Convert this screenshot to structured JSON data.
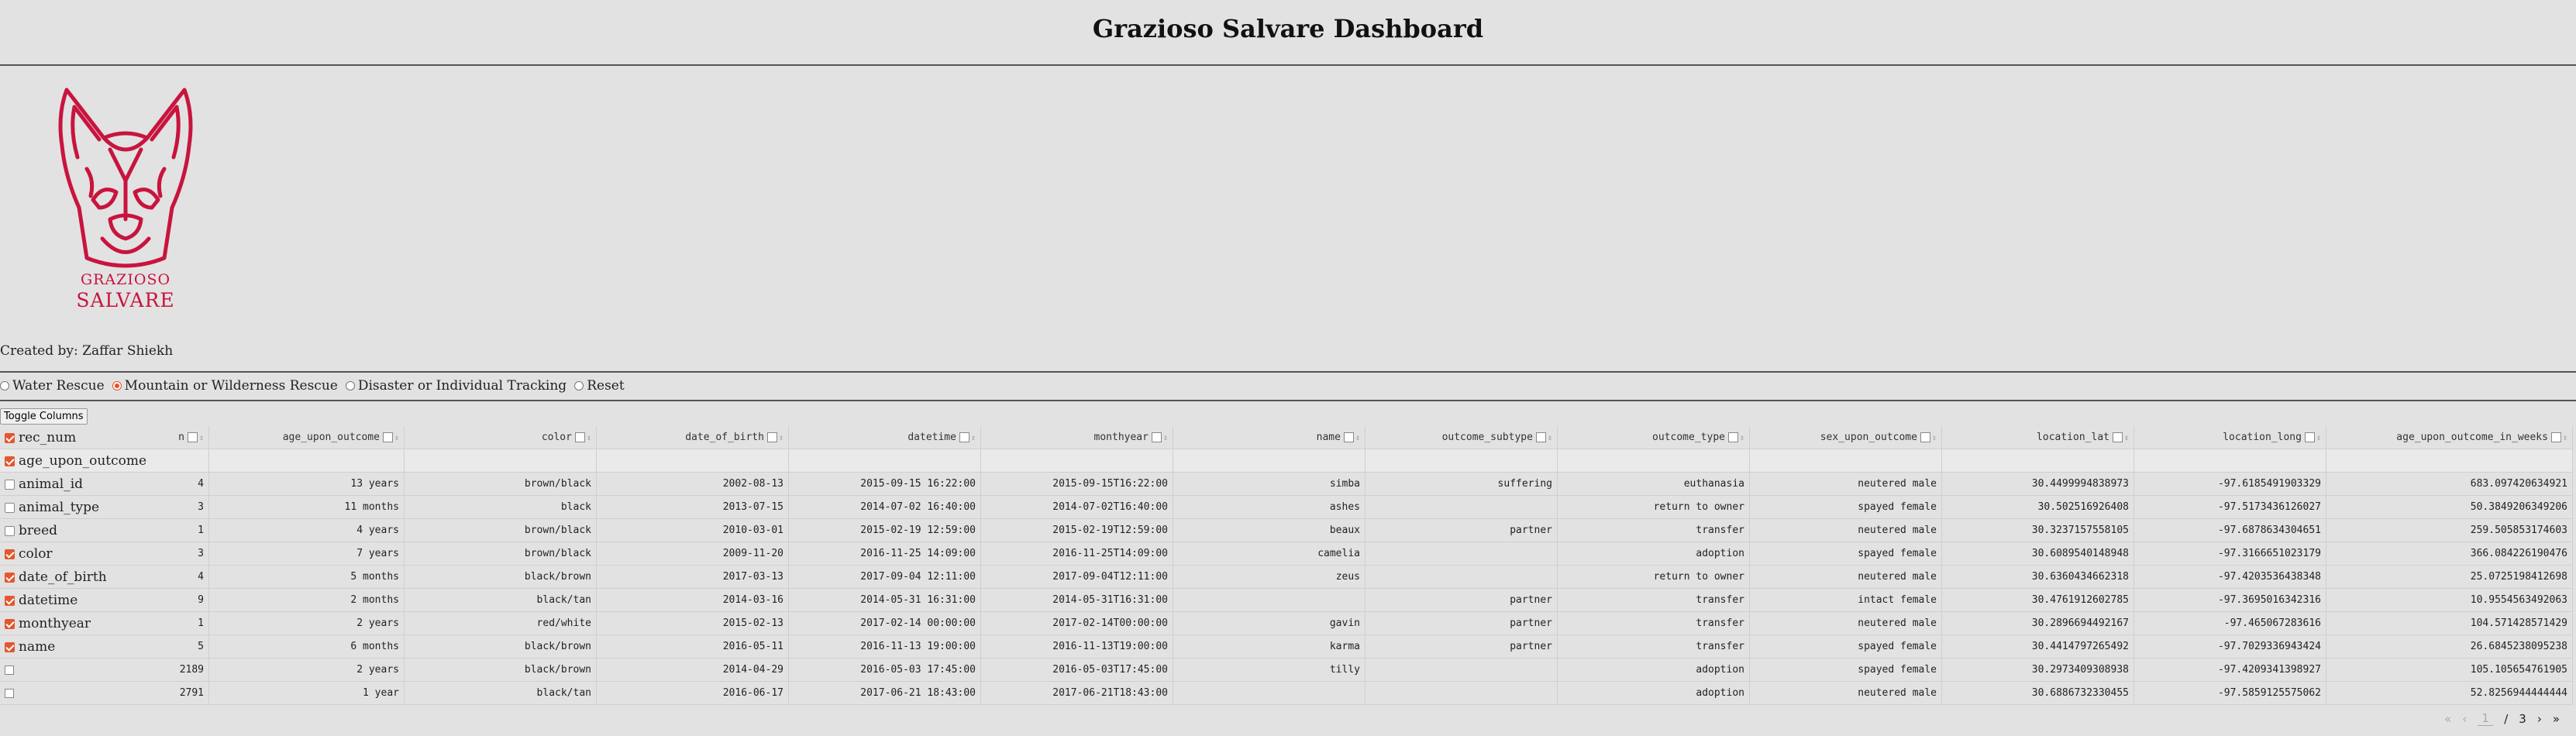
{
  "app": {
    "title": "Grazioso Salvare Dashboard",
    "logo_line1": "GRAZIOSO",
    "logo_line2": "SALVARE",
    "created_by": "Created by: Zaffar Shiekh",
    "brand_color": "#c8143e",
    "accent_color": "#e4572e"
  },
  "filters": {
    "options": [
      {
        "label": "Water Rescue",
        "checked": false
      },
      {
        "label": "Mountain or Wilderness Rescue",
        "checked": true
      },
      {
        "label": "Disaster or Individual Tracking",
        "checked": false
      },
      {
        "label": "Reset",
        "checked": false
      }
    ]
  },
  "toggle_columns_label": "Toggle Columns",
  "column_menu": [
    {
      "label": "rec_num",
      "checked": true
    },
    {
      "label": "age_upon_outcome",
      "checked": true
    },
    {
      "label": "animal_id",
      "checked": false
    },
    {
      "label": "animal_type",
      "checked": false
    },
    {
      "label": "breed",
      "checked": false
    },
    {
      "label": "color",
      "checked": true
    },
    {
      "label": "date_of_birth",
      "checked": true
    },
    {
      "label": "datetime",
      "checked": true
    },
    {
      "label": "monthyear",
      "checked": true
    },
    {
      "label": "name",
      "checked": true
    }
  ],
  "table": {
    "columns": [
      "n",
      "age_upon_outcome",
      "color",
      "date_of_birth",
      "datetime",
      "monthyear",
      "name",
      "outcome_subtype",
      "outcome_type",
      "sex_upon_outcome",
      "location_lat",
      "location_long",
      "age_upon_outcome_in_weeks"
    ],
    "rows": [
      [
        "4",
        "13 years",
        "brown/black",
        "2002-08-13",
        "2015-09-15 16:22:00",
        "2015-09-15T16:22:00",
        "simba",
        "suffering",
        "euthanasia",
        "neutered male",
        "30.4499994838973",
        "-97.6185491903329",
        "683.097420634921"
      ],
      [
        "3",
        "11 months",
        "black",
        "2013-07-15",
        "2014-07-02 16:40:00",
        "2014-07-02T16:40:00",
        "ashes",
        "",
        "return to owner",
        "spayed female",
        "30.502516926408",
        "-97.5173436126027",
        "50.3849206349206"
      ],
      [
        "1",
        "4 years",
        "brown/black",
        "2010-03-01",
        "2015-02-19 12:59:00",
        "2015-02-19T12:59:00",
        "beaux",
        "partner",
        "transfer",
        "neutered male",
        "30.3237157558105",
        "-97.6878634304651",
        "259.505853174603"
      ],
      [
        "3",
        "7 years",
        "brown/black",
        "2009-11-20",
        "2016-11-25 14:09:00",
        "2016-11-25T14:09:00",
        "camelia",
        "",
        "adoption",
        "spayed female",
        "30.6089540148948",
        "-97.3166651023179",
        "366.084226190476"
      ],
      [
        "4",
        "5 months",
        "black/brown",
        "2017-03-13",
        "2017-09-04 12:11:00",
        "2017-09-04T12:11:00",
        "zeus",
        "",
        "return to owner",
        "neutered male",
        "30.6360434662318",
        "-97.4203536438348",
        "25.0725198412698"
      ],
      [
        "9",
        "2 months",
        "black/tan",
        "2014-03-16",
        "2014-05-31 16:31:00",
        "2014-05-31T16:31:00",
        "",
        "partner",
        "transfer",
        "intact female",
        "30.4761912602785",
        "-97.3695016342316",
        "10.9554563492063"
      ],
      [
        "1",
        "2 years",
        "red/white",
        "2015-02-13",
        "2017-02-14 00:00:00",
        "2017-02-14T00:00:00",
        "gavin",
        "partner",
        "transfer",
        "neutered male",
        "30.2896694492167",
        "-97.465067283616",
        "104.571428571429"
      ],
      [
        "5",
        "6 months",
        "black/brown",
        "2016-05-11",
        "2016-11-13 19:00:00",
        "2016-11-13T19:00:00",
        "karma",
        "partner",
        "transfer",
        "spayed female",
        "30.4414797265492",
        "-97.7029336943424",
        "26.6845238095238"
      ],
      [
        "2189",
        "2 years",
        "black/brown",
        "2014-04-29",
        "2016-05-03 17:45:00",
        "2016-05-03T17:45:00",
        "tilly",
        "",
        "adoption",
        "spayed female",
        "30.2973409308938",
        "-97.4209341398927",
        "105.105654761905"
      ],
      [
        "2791",
        "1 year",
        "black/tan",
        "2016-06-17",
        "2017-06-21 18:43:00",
        "2017-06-21T18:43:00",
        "",
        "",
        "adoption",
        "neutered male",
        "30.6886732330455",
        "-97.5859125575062",
        "52.8256944444444"
      ]
    ]
  },
  "pager": {
    "first": "«",
    "prev": "‹",
    "current": "1",
    "separator": "/",
    "total": "3",
    "next": "›",
    "last": "»"
  }
}
